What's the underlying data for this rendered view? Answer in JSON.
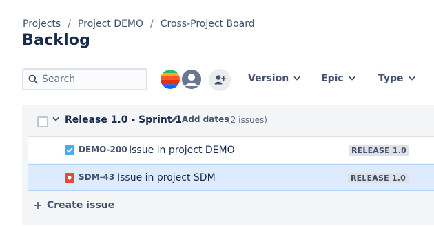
{
  "breadcrumb": {
    "items": [
      "Projects",
      "Project DEMO",
      "Cross-Project Board"
    ],
    "separator": "/"
  },
  "page": {
    "title": "Backlog"
  },
  "toolbar": {
    "search": {
      "placeholder": "Search",
      "value": ""
    },
    "filters": {
      "version": "Version",
      "epic": "Epic",
      "type": "Type"
    }
  },
  "sprint": {
    "name": "Release 1.0 - Sprint 1",
    "add_dates_label": "Add dates",
    "issue_count_label": "(2 issues)",
    "issues": [
      {
        "key": "DEMO-200",
        "summary": "Issue in project DEMO",
        "type": "story",
        "version": "RELEASE 1.0",
        "selected": false
      },
      {
        "key": "SDM-43",
        "summary": "Issue in project SDM",
        "type": "bug",
        "version": "RELEASE 1.0",
        "selected": true
      }
    ],
    "create_issue_label": "Create issue"
  },
  "colors": {
    "accent": "#0052cc",
    "story": "#4bade8",
    "bug": "#e5493a",
    "selected_row": "#deebff",
    "sprint_bg": "#f4f5f7"
  }
}
